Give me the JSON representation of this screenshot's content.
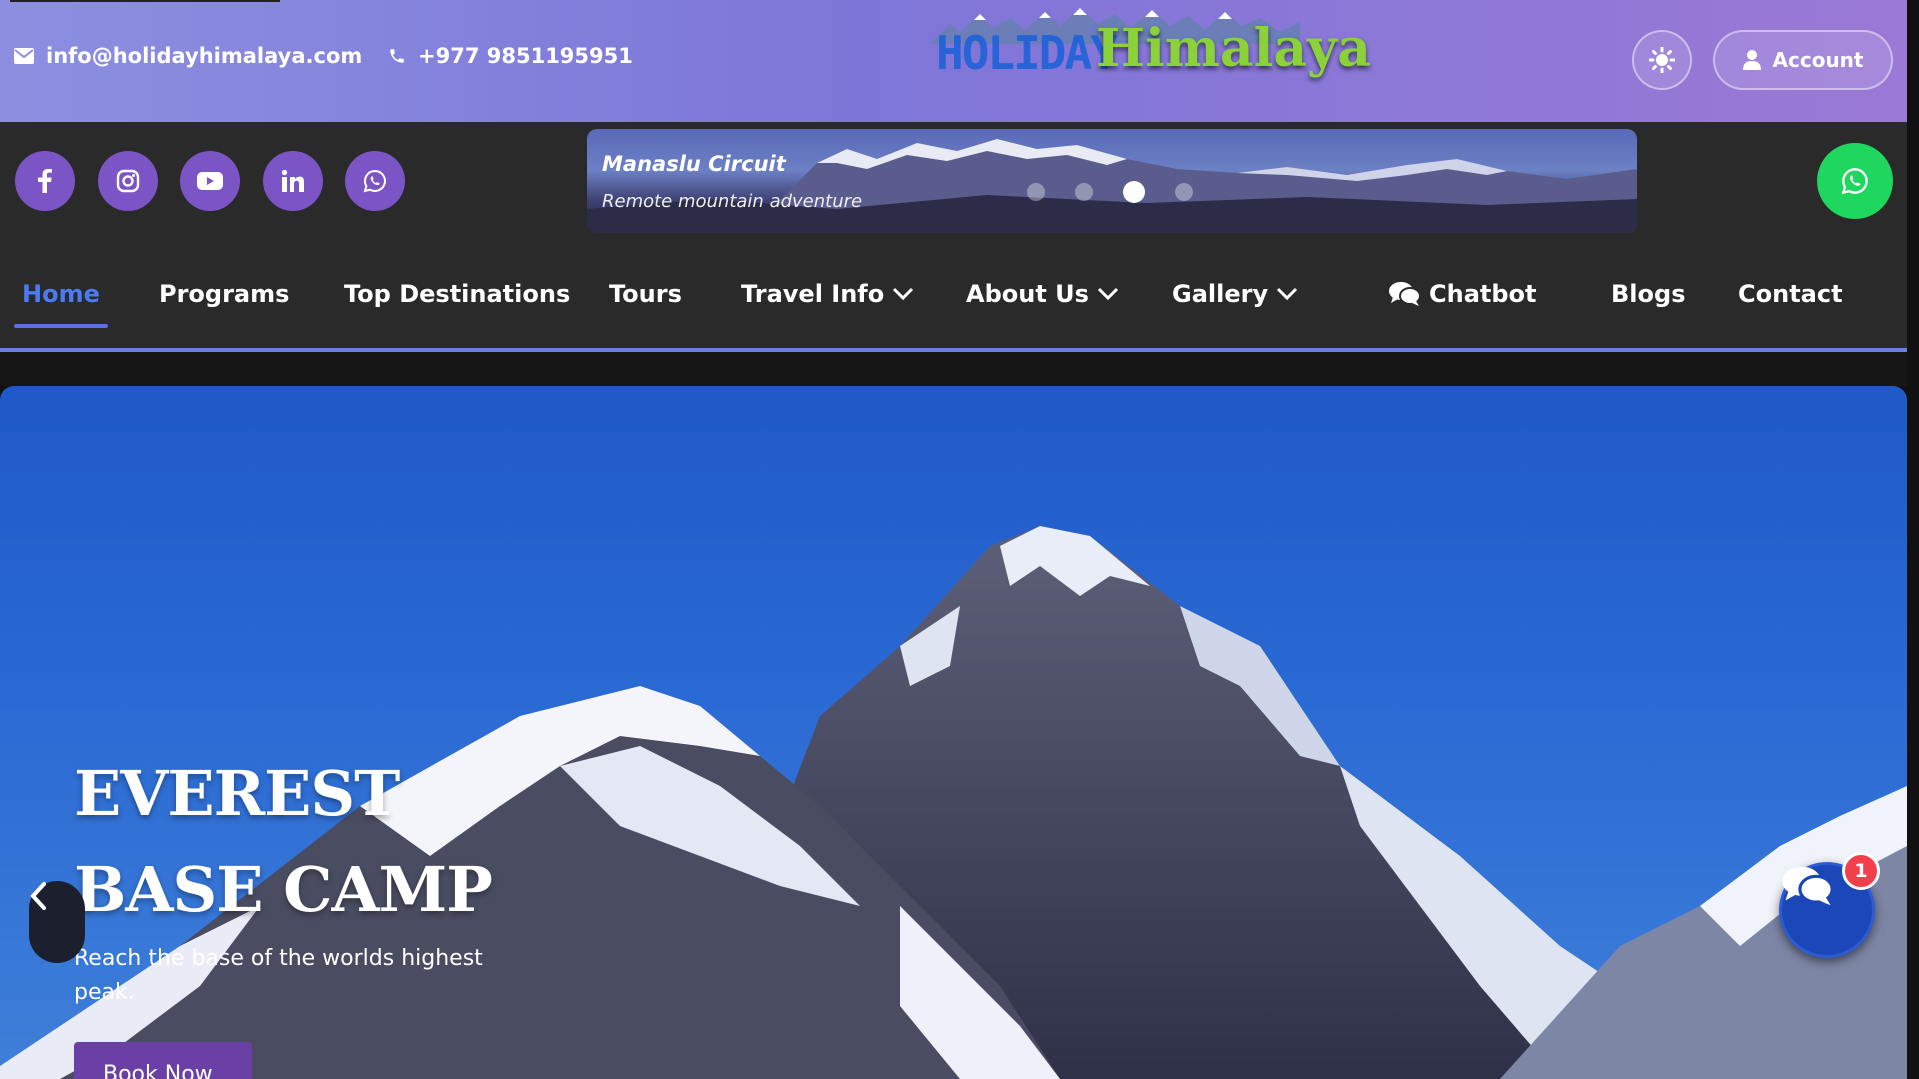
{
  "topbar": {
    "email": "info@holidayhimalaya.com",
    "phone": "+977 9851195951",
    "logo_part1": "HOLIDAY",
    "logo_part2": "Himalaya",
    "account_label": "Account"
  },
  "social": [
    "facebook-icon",
    "instagram-icon",
    "youtube-icon",
    "linkedin-icon",
    "whatsapp-icon"
  ],
  "ticker": {
    "title": "Manaslu Circuit",
    "subtitle": "Remote mountain adventure",
    "slide_count": 4,
    "active_slide": 3
  },
  "nav": {
    "items": [
      {
        "label": "Home",
        "active": true
      },
      {
        "label": "Programs"
      },
      {
        "label": "Top Destinations"
      },
      {
        "label": "Tours"
      },
      {
        "label": "Travel Info",
        "dropdown": true
      },
      {
        "label": "About Us",
        "dropdown": true
      },
      {
        "label": "Gallery",
        "dropdown": true
      },
      {
        "label": "Chatbot",
        "icon": "chat-icon"
      },
      {
        "label": "Blogs"
      },
      {
        "label": "Contact"
      }
    ]
  },
  "hero": {
    "title": "EVEREST BASE CAMP",
    "description": "Reach the base of the worlds highest peak.",
    "cta": "Book Now"
  },
  "chat_widget": {
    "badge_count": "1"
  },
  "colors": {
    "topbar_gradient_start": "#8c8fe0",
    "topbar_gradient_end": "#9b79d6",
    "accent_purple": "#7b55c6",
    "nav_active": "#4a7bf0",
    "whatsapp_green": "#1fd65f",
    "badge_red": "#f33f4b"
  }
}
